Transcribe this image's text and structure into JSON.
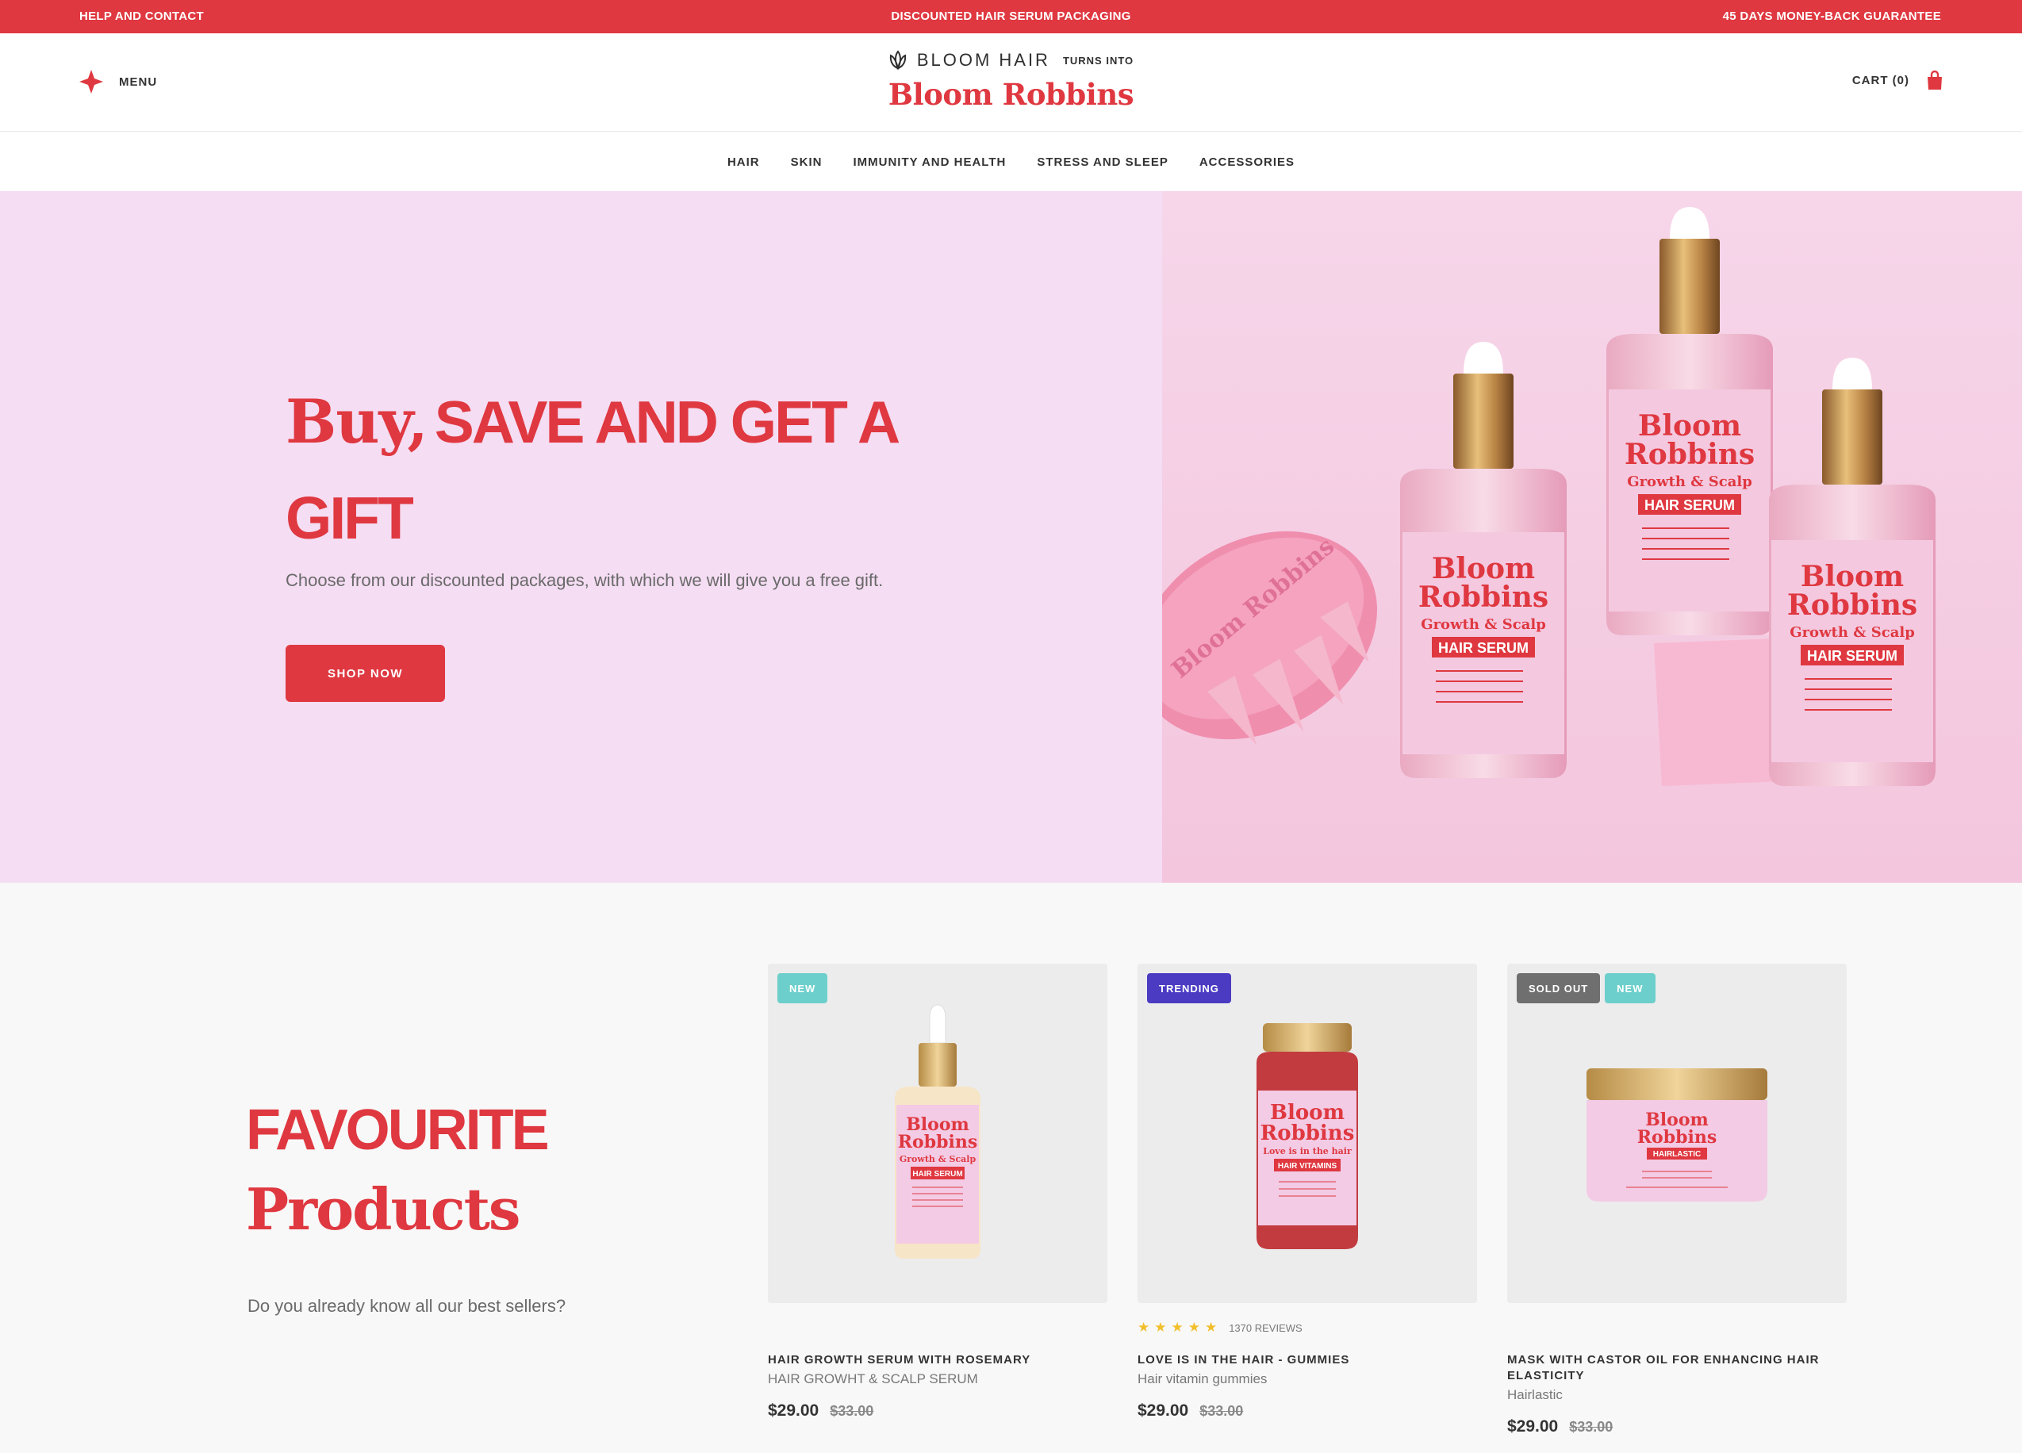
{
  "topbar": {
    "left": "HELP AND CONTACT",
    "center": "DISCOUNTED HAIR SERUM PACKAGING",
    "right": "45 DAYS MONEY-BACK GUARANTEE"
  },
  "header": {
    "menu_label": "MENU",
    "logo_brand": "BLOOM HAIR",
    "logo_turns": "TURNS INTO",
    "logo_main": "Bloom Robbins",
    "cart_label": "CART (0)"
  },
  "nav": [
    "HAIR",
    "SKIN",
    "IMMUNITY AND HEALTH",
    "STRESS AND SLEEP",
    "ACCESSORIES"
  ],
  "hero": {
    "title_serif": "Buy,",
    "title_sans": "SAVE AND GET A GIFT",
    "subtitle": "Choose from our discounted packages, with which we will give you a free gift.",
    "button": "SHOP NOW",
    "bottle_brand_line1": "Bloom",
    "bottle_brand_line2": "Robbins",
    "bottle_variant": "Growth & Scalp",
    "bottle_product": "HAIR SERUM",
    "brush_text": "Bloom Robbins"
  },
  "favourites": {
    "title_line1": "FAVOURITE",
    "title_line2": "Products",
    "subtitle": "Do you already know all our best sellers?"
  },
  "products": [
    {
      "badges": [
        {
          "text": "NEW",
          "color": "#6dcfcb"
        }
      ],
      "rating": null,
      "name": "HAIR GROWTH SERUM WITH ROSEMARY",
      "subname": "HAIR GROWHT & SCALP SERUM",
      "price": "$29.00",
      "old_price": "$33.00",
      "label_brand1": "Bloom",
      "label_brand2": "Robbins",
      "label_variant": "Growth & Scalp",
      "label_product": "HAIR SERUM"
    },
    {
      "badges": [
        {
          "text": "TRENDING",
          "color": "#4b3bc3"
        }
      ],
      "rating": {
        "stars": "★★★★★",
        "value": 5,
        "reviews": "1370 REVIEWS"
      },
      "name": "LOVE IS IN THE HAIR - GUMMIES",
      "subname": "Hair vitamin gummies",
      "price": "$29.00",
      "old_price": "$33.00",
      "label_brand1": "Bloom",
      "label_brand2": "Robbins",
      "label_variant": "Love is in the hair",
      "label_product": "HAIR VITAMINS"
    },
    {
      "badges": [
        {
          "text": "SOLD OUT",
          "color": "#6f6f6f"
        },
        {
          "text": "NEW",
          "color": "#6dcfcb"
        }
      ],
      "rating": null,
      "name": "MASK WITH CASTOR OIL FOR ENHANCING HAIR ELASTICITY",
      "subname": "Hairlastic",
      "price": "$29.00",
      "old_price": "$33.00",
      "label_brand1": "Bloom",
      "label_brand2": "Robbins",
      "label_variant": "",
      "label_product": "HAIRLASTIC"
    }
  ],
  "colors": {
    "accent": "#df3840",
    "hero_bg": "#f5ddf3",
    "card_bg": "#ececec",
    "badge_new": "#6dcfcb",
    "badge_trending": "#4b3bc3",
    "badge_sold_out": "#6f6f6f",
    "star": "#f2bf2c"
  }
}
